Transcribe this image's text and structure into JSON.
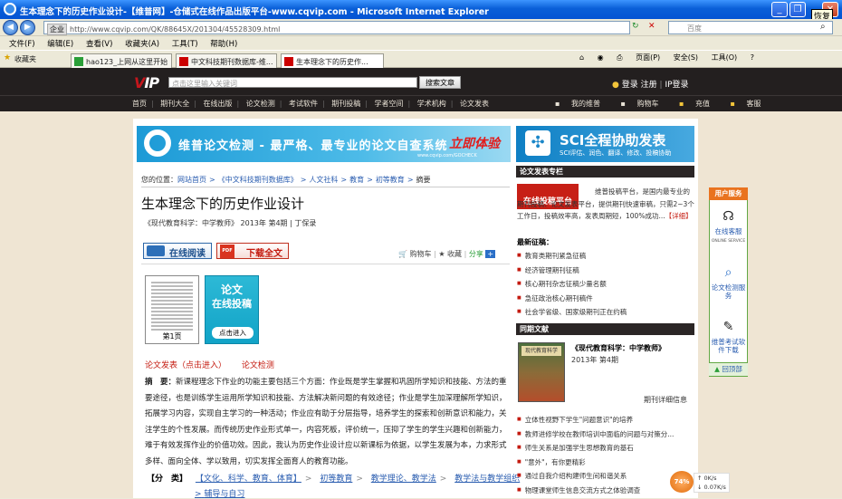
{
  "window": {
    "title": "生本理念下的历史作业设计-【维普网】-仓储式在线作品出版平台-www.cqvip.com - Microsoft Internet Explorer",
    "tooltip": "恢复"
  },
  "addressbar": {
    "mode": "企业",
    "url": "http://www.cqvip.com/QK/88645X/201304/45528309.html",
    "search_placeholder": "百度"
  },
  "menu": [
    "文件(F)",
    "编辑(E)",
    "查看(V)",
    "收藏夹(A)",
    "工具(T)",
    "帮助(H)"
  ],
  "favorites": {
    "label": "收藏夹"
  },
  "tabs": [
    "hao123_上网从这里开始",
    "中文科技期刊数据库-维...",
    "生本理念下的历史作..."
  ],
  "ie_toolbar": [
    "页面(P)",
    "安全(S)",
    "工具(O)",
    "?"
  ],
  "site": {
    "logo_v": "V",
    "logo_ip": "IP",
    "search_placeholder": "点击这里输入关键词",
    "search_button": "搜索文章",
    "login": "登录",
    "register": "注册",
    "ip_login": "IP登录",
    "nav": [
      "首页",
      "期刊大全",
      "在线出版",
      "论文检测",
      "考试软件",
      "期刊投稿",
      "学者空间",
      "学术机构",
      "论文发表"
    ],
    "nav_right": [
      "我的维普",
      "购物车",
      "充值",
      "客服"
    ]
  },
  "banner1": {
    "text": "维普论文检测 - 最严格、最专业的论文自查系统",
    "cta": "立即体验",
    "url": "www.cqvip.com/GOCHECK"
  },
  "banner2": {
    "title": "SCI全程协助发表",
    "sub": "SCI评估、润色、翻译、修改、投稿协助"
  },
  "breadcrumb": {
    "label": "您的位置：",
    "items": [
      "网站首页",
      "《中文科技期刊数据库》",
      "人文社科",
      "教育",
      "初等教育"
    ],
    "current": "摘要"
  },
  "article": {
    "title": "生本理念下的历史作业设计",
    "meta": "《现代教育科学：中学教师》 2013年 第4期 | 丁保录",
    "read_btn": "在线阅读",
    "dl_btn": "下载全文",
    "pdf_label": "PDF",
    "cart": "购物车",
    "fav": "收藏",
    "share": "分享",
    "thumb_label": "第1页",
    "tougao1": "论文",
    "tougao2": "在线投稿",
    "tougao_btn": "点击进入",
    "link1": "论文发表（点击进入）",
    "link2": "论文检测",
    "abstract_label": "摘　要：",
    "abstract": "新课程理念下作业的功能主要包括三个方面：作业既是学生掌握和巩固所学知识和技能、方法的重要途径，也是训练学生运用所学知识和技能、方法解决新问题的有效途径；作业是学生加深理解所学知识，拓展学习内容，实现自主学习的一种活动；作业应有助于分层指导，培养学生的探索和创新意识和能力，关注学生的个性发展。而传统历史作业形式单一，内容死板，评价统一，压抑了学生的学生兴趣和创新能力，难于有效发挥作业的价值功效。因此，我认为历史作业设计应以新课标为依据，以学生发展为本，力求形式多样、面向全体、学以致用，切实发挥全面育人的教育功能。",
    "class_label": "【分　类】",
    "class_items": [
      "【文化、科学、教育、体育】",
      "初等教育",
      "教学理论、教学法",
      "教学法与教学组织"
    ],
    "class_sep": ">",
    "class_more": "辅导与自习"
  },
  "sidebar": {
    "sec1": "论文发表专栏",
    "pub_badge": "在线投稿平台",
    "pub_text": "维普投稿平台，是国内最专业的期刊投稿、论文发表平台，提供期刊快速审稿，只需2~3个工作日，投稿效率高，发表周期短，100%成功...",
    "pub_link": "【详细】",
    "new_label": "最新征稿：",
    "new_items": [
      "教育类期刊紧急征稿",
      "经济管理期刊征稿",
      "核心期刊杂志征稿少量名额",
      "急征政治核心期刊稿件",
      "社会学省级、国家级期刊正在约稿"
    ],
    "sec2": "同期文献",
    "cover_text": "现代教育科学",
    "mag_title": "《现代教育科学：中学教师》",
    "mag_meta": "2013年 第4期",
    "mag_detail": "期刊详细信息",
    "mag_items": [
      "立体性视野下学生\"问题意识\"的培养",
      "教师进修学校在教师培训中面临的问题与对策分...",
      "师生关系是加强学生思想教育的基石",
      "\"意外\"，有你更精彩",
      "通过自我介绍构建师生间和谐关系",
      "物理课堂师生信息交流方式之体验调查"
    ]
  },
  "service": {
    "header": "用户服务",
    "items": [
      "在线客服",
      "论文检测服务",
      "维普考试软件下载"
    ],
    "online_sub": "ONLINE SERVICE",
    "top": "回顶部"
  },
  "speed": {
    "pct": "74%",
    "up": "0K/s",
    "down": "0.07K/s"
  }
}
